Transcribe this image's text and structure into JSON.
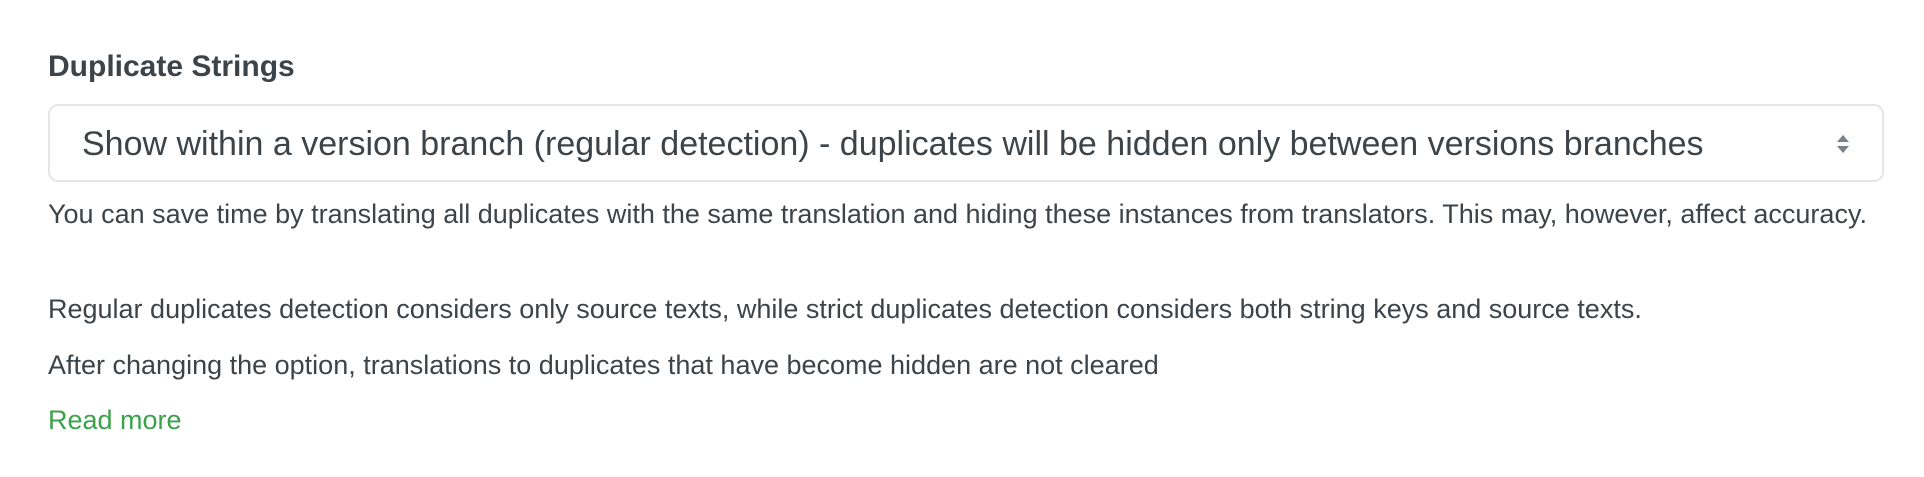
{
  "duplicates": {
    "label": "Duplicate Strings",
    "selected_option": "Show within a version branch (regular detection) - duplicates will be hidden only between versions branches",
    "help_lines": [
      "You can save time by translating all duplicates with the same translation and hiding these instances from translators. This may, however, affect accuracy.",
      "Regular duplicates detection considers only source texts, while strict duplicates detection considers both string keys and source texts.",
      "After changing the option, translations to duplicates that have become hidden are not cleared"
    ],
    "read_more_link": "Read more"
  },
  "icons": {
    "select_arrows": "sort-arrows-icon"
  },
  "colors": {
    "text": "#3d4449",
    "link": "#3aa24a",
    "border": "#e4e6e8"
  }
}
